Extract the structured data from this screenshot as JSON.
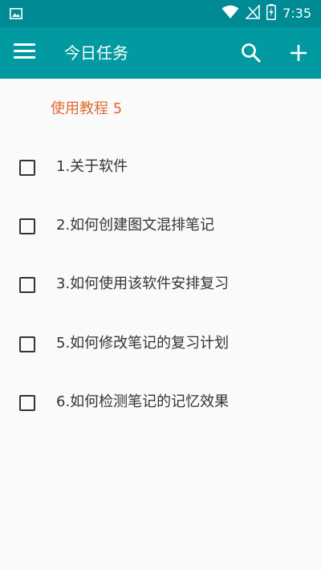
{
  "status_bar": {
    "time": "7:35",
    "icons": [
      "image-icon",
      "wifi-icon",
      "no-signal-icon",
      "battery-charging-icon"
    ]
  },
  "app_bar": {
    "title": "今日任务",
    "menu_icon": "hamburger-menu-icon",
    "search_icon": "search-icon",
    "add_icon": "plus-icon"
  },
  "section": {
    "title": "使用教程 5"
  },
  "tasks": [
    {
      "label": "1.关于软件",
      "checked": false
    },
    {
      "label": "2.如何创建图文混排笔记",
      "checked": false
    },
    {
      "label": "3.如何使用该软件安排复习",
      "checked": false
    },
    {
      "label": "5.如何修改笔记的复习计划",
      "checked": false
    },
    {
      "label": "6.如何检测笔记的记忆效果",
      "checked": false
    }
  ],
  "colors": {
    "status_bar": "#008a93",
    "app_bar": "#009aa0",
    "section_title": "#e06a2e",
    "background": "#fafafa"
  }
}
